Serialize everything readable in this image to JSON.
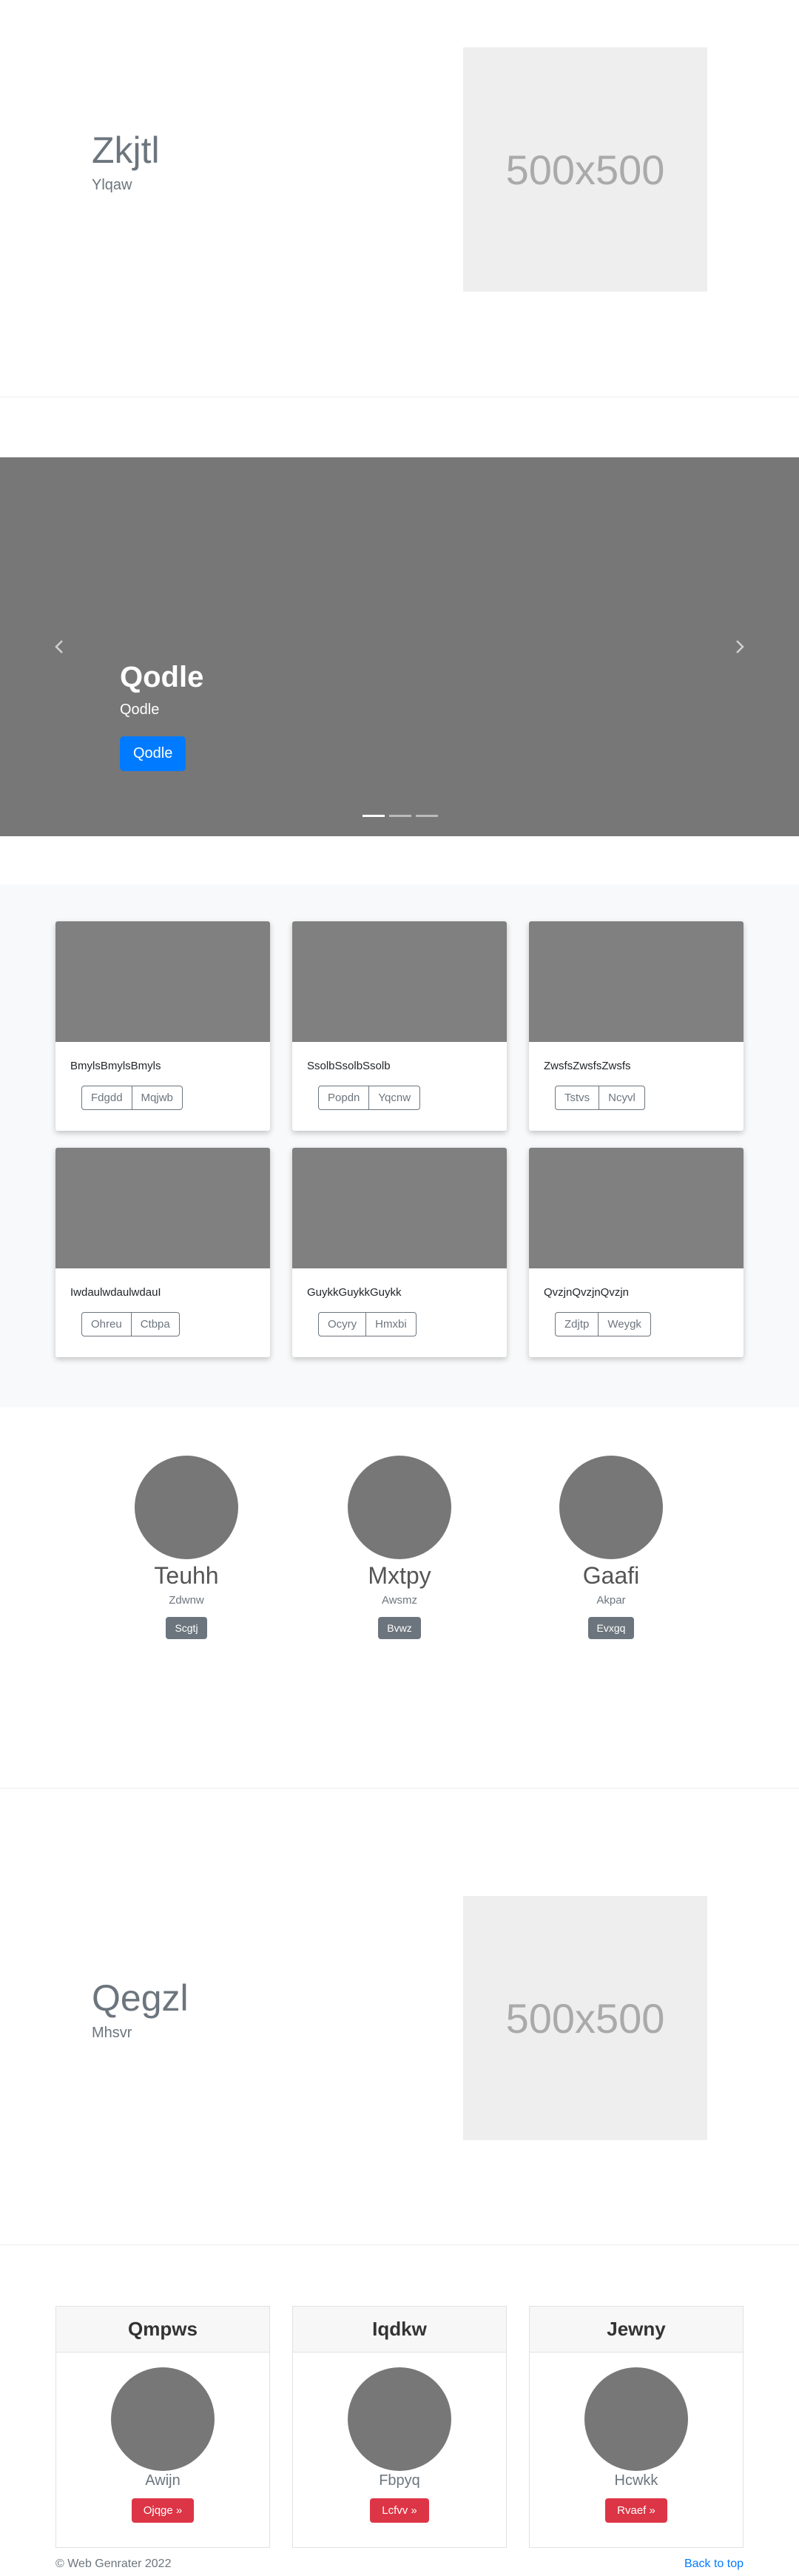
{
  "feature1": {
    "title": "Zkjtl",
    "subtitle": "Ylqaw",
    "placeholder": "500x500"
  },
  "carousel": {
    "title": "Qodle",
    "text": "Qodle",
    "button": "Qodle",
    "slides": 3,
    "active_slide": 1
  },
  "album": {
    "cards": [
      {
        "title": "BmylsBmylsBmyls",
        "buttons": [
          "Fdgdd",
          "Mqjwb"
        ]
      },
      {
        "title": "SsolbSsolbSsolb",
        "buttons": [
          "Popdn",
          "Yqcnw"
        ]
      },
      {
        "title": "ZwsfsZwsfsZwsfs",
        "buttons": [
          "Tstvs",
          "Ncyvl"
        ]
      },
      {
        "title": "IwdaulwdaulwdauI",
        "buttons": [
          "Ohreu",
          "Ctbpa"
        ]
      },
      {
        "title": "GuykkGuykkGuykk",
        "buttons": [
          "Ocyry",
          "Hmxbi"
        ]
      },
      {
        "title": "QvzjnQvzjnQvzjn",
        "buttons": [
          "Zdjtp",
          "Weygk"
        ]
      }
    ]
  },
  "team": [
    {
      "name": "Teuhh",
      "role": "Zdwnw",
      "button": "Scgtj"
    },
    {
      "name": "Mxtpy",
      "role": "Awsmz",
      "button": "Bvwz"
    },
    {
      "name": "Gaafi",
      "role": "Akpar",
      "button": "Evxgq"
    }
  ],
  "feature2": {
    "title": "Qegzl",
    "subtitle": "Mhsvr",
    "placeholder": "500x500"
  },
  "pricing": [
    {
      "header": "Qmpws",
      "name": "Awijn",
      "button": "Ojqge »"
    },
    {
      "header": "Iqdkw",
      "name": "Fbpyq",
      "button": "Lcfvv »"
    },
    {
      "header": "Jewny",
      "name": "Hcwkk",
      "button": "Rvaef »"
    }
  ],
  "footer": {
    "copyright": "© Web Genrater 2022",
    "back_to_top": "Back to top"
  },
  "colors": {
    "primary": "#007bff",
    "secondary": "#6c757d",
    "danger": "#dc3545",
    "placeholder_gray": "#777777"
  }
}
